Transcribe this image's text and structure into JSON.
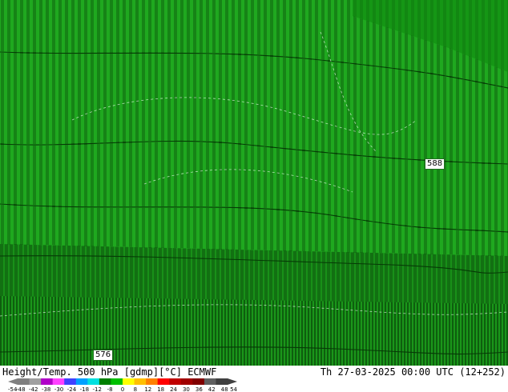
{
  "map": {
    "background_color": "#1a9e1a",
    "contour_labels": [
      {
        "text": "588"
      },
      {
        "text": "576"
      }
    ]
  },
  "footer": {
    "title": "Height/Temp. 500 hPa [gdmp][°C] ECMWF",
    "valid_time": "Th 27-03-2025 00:00 UTC (12+252)"
  },
  "colorbar": {
    "ticks": [
      "-54",
      "-48",
      "-42",
      "-38",
      "-30",
      "-24",
      "-18",
      "-12",
      "-8",
      "0",
      "8",
      "12",
      "18",
      "24",
      "30",
      "36",
      "42",
      "48",
      "54"
    ],
    "colors": [
      "#7f7f7f",
      "#a0a0a0",
      "#b000c8",
      "#ff40ff",
      "#4040ff",
      "#00a0ff",
      "#00e0e0",
      "#008000",
      "#00c000",
      "#ffff00",
      "#ffc000",
      "#ff8000",
      "#ff0000",
      "#c00000",
      "#a00000",
      "#800000",
      "#606060",
      "#404040"
    ]
  }
}
